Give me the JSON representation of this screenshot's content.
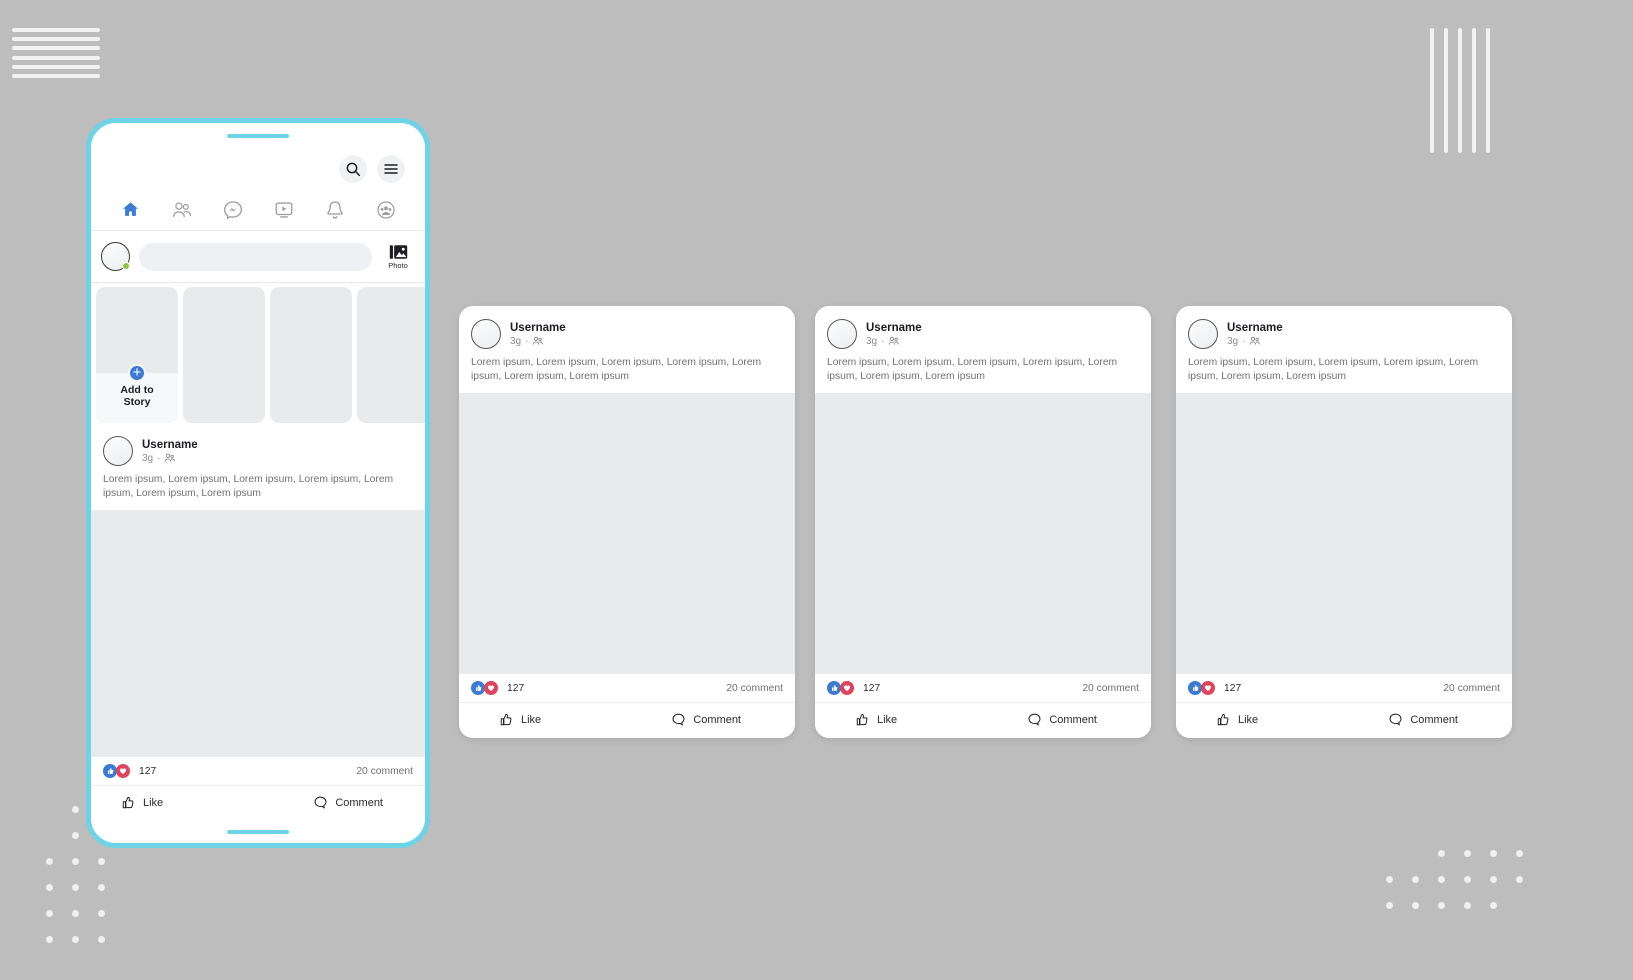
{
  "theme": {
    "background": "#bdbdbd",
    "accent": "#6dd3e7",
    "brand_blue": "#3b7bd4",
    "love_red": "#e0435c",
    "placeholder_gray": "#e9eaec"
  },
  "phone": {
    "topbar": {
      "search_icon": "search-icon",
      "menu_icon": "hamburger-menu-icon"
    },
    "nav": [
      {
        "name": "home-icon",
        "label": "Home",
        "active": true
      },
      {
        "name": "friends-icon",
        "label": "Friends",
        "active": false
      },
      {
        "name": "messenger-icon",
        "label": "Messenger",
        "active": false
      },
      {
        "name": "video-icon",
        "label": "Watch",
        "active": false
      },
      {
        "name": "bell-icon",
        "label": "Notifications",
        "active": false
      },
      {
        "name": "groups-icon",
        "label": "Groups",
        "active": false
      }
    ],
    "composer": {
      "avatar": "user-avatar",
      "input_placeholder": "",
      "input_value": "",
      "photo_label": "Photo",
      "photo_icon": "photo-icon",
      "online_status": "online"
    },
    "stories": {
      "add_story_label": "Add to\nStory",
      "add_story_line1": "Add to",
      "add_story_line2": "Story",
      "plus_icon": "plus-circle-icon",
      "count": 4
    },
    "post": {
      "username": "Username",
      "time": "3g",
      "separator": "·",
      "audience_icon": "friends-audience-icon",
      "body": "Lorem ipsum, Lorem ipsum, Lorem ipsum, Lorem ipsum, Lorem ipsum, Lorem ipsum, Lorem ipsum",
      "reaction_count": "127",
      "comment_count": "20 comment",
      "like_icon": "thumbs-up-reaction-icon",
      "love_icon": "heart-reaction-icon",
      "like_label": "Like",
      "like_button_icon": "thumbs-up-outline-icon",
      "comment_label": "Comment",
      "comment_button_icon": "speech-bubble-icon"
    }
  },
  "cards": [
    {
      "username": "Username",
      "time": "3g",
      "separator": "·",
      "body": "Lorem ipsum, Lorem ipsum, Lorem ipsum, Lorem ipsum, Lorem ipsum, Lorem ipsum, Lorem ipsum",
      "reaction_count": "127",
      "comment_count": "20 comment",
      "like_label": "Like",
      "comment_label": "Comment"
    },
    {
      "username": "Username",
      "time": "3g",
      "separator": "·",
      "body": "Lorem ipsum, Lorem ipsum, Lorem ipsum, Lorem ipsum, Lorem ipsum, Lorem ipsum, Lorem ipsum",
      "reaction_count": "127",
      "comment_count": "20 comment",
      "like_label": "Like",
      "comment_label": "Comment"
    },
    {
      "username": "Username",
      "time": "3g",
      "separator": "·",
      "body": "Lorem ipsum, Lorem ipsum, Lorem ipsum, Lorem ipsum, Lorem ipsum, Lorem ipsum, Lorem ipsum",
      "reaction_count": "127",
      "comment_count": "20 comment",
      "like_label": "Like",
      "comment_label": "Comment"
    }
  ],
  "decor": {
    "top_left_lines": 6,
    "top_right_lines": 5,
    "bottom_left_dots": "3x6 dot grid",
    "bottom_right_dots": "6x3 dot grid"
  }
}
